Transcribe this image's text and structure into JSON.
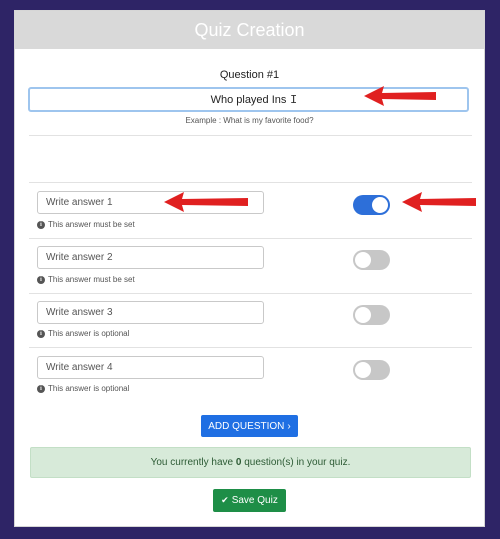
{
  "header": {
    "title": "Quiz Creation"
  },
  "question": {
    "label": "Question #1",
    "value": "Who played Ins",
    "hint": "Example : What is my favorite food?"
  },
  "answers": [
    {
      "placeholder": "Write answer 1",
      "note": "This answer must be set",
      "correct": true
    },
    {
      "placeholder": "Write answer 2",
      "note": "This answer must be set",
      "correct": false
    },
    {
      "placeholder": "Write answer 3",
      "note": "This answer is optional",
      "correct": false
    },
    {
      "placeholder": "Write answer 4",
      "note": "This answer is optional",
      "correct": false
    }
  ],
  "buttons": {
    "add_question": "ADD QUESTION",
    "save_quiz": "Save Quiz"
  },
  "status": {
    "prefix": "You currently have",
    "count": "0",
    "suffix": "question(s) in your quiz."
  },
  "icons": {
    "info": "info-circle-icon",
    "chevron": "chevron-right-icon",
    "check": "check-icon",
    "annotation": "red-arrow-icon"
  },
  "colors": {
    "background": "#2e2466",
    "header": "#d9d9d9",
    "toggle_on": "#2d6fd9",
    "toggle_off": "#c7c7c7",
    "add_button": "#1f6fe3",
    "save_button": "#1e8e47",
    "status_bg": "#d7ead9",
    "annotation_arrow": "#e02020"
  }
}
